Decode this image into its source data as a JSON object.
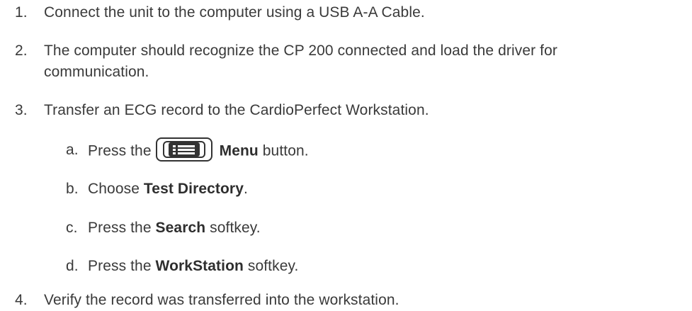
{
  "steps": [
    {
      "number": "1.",
      "text": "Connect the unit to the computer using a USB A-A Cable."
    },
    {
      "number": "2.",
      "line1": "The computer should recognize the CP 200 connected and load the driver for",
      "line2": "communication."
    },
    {
      "number": "3.",
      "text": "Transfer an ECG record to the CardioPerfect Workstation."
    },
    {
      "number": "4.",
      "text": "Verify the record was transferred into the workstation."
    }
  ],
  "substeps": {
    "a": {
      "letter": "a.",
      "pre": "Press the",
      "bold": "Menu",
      "post": " button.",
      "icon": "menu-list-icon"
    },
    "b": {
      "letter": "b.",
      "pre": "Choose ",
      "bold": "Test Directory",
      "post": "."
    },
    "c": {
      "letter": "c.",
      "pre": "Press the ",
      "bold": "Search",
      "post": " softkey."
    },
    "d": {
      "letter": "d.",
      "pre": "Press the ",
      "bold": "WorkStation",
      "post": " softkey."
    }
  }
}
